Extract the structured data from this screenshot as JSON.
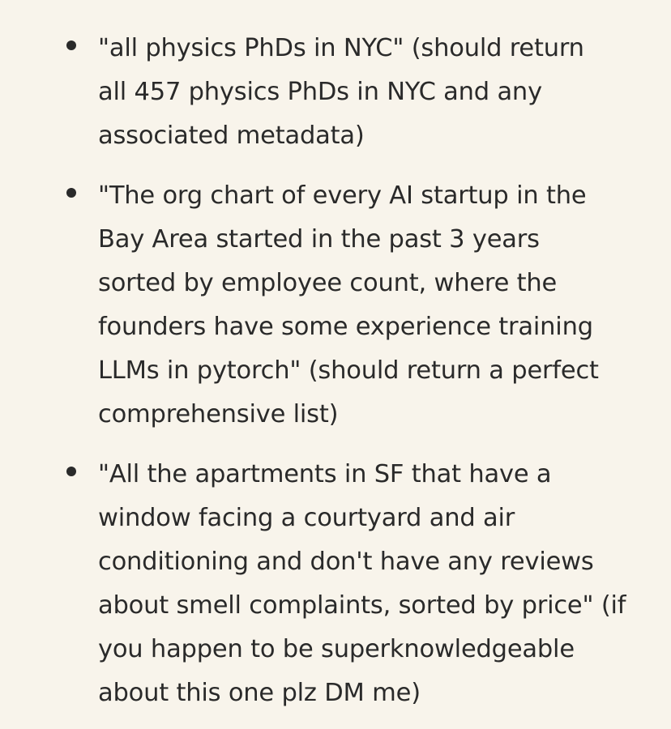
{
  "items": [
    {
      "lines": [
        "\"all physics PhDs in NYC\" (should return",
        "all 457 physics PhDs in NYC and any",
        "associated metadata)"
      ]
    },
    {
      "lines": [
        "\"The org chart of every AI startup in the",
        "Bay Area started in the past 3 years",
        "sorted by employee count, where the",
        "founders have some experience training",
        "LLMs in pytorch\" (should return a perfect",
        "comprehensive list)"
      ]
    },
    {
      "lines": [
        "\"All the apartments in SF that have a",
        "window facing a courtyard and air",
        "conditioning and don't have any reviews",
        "about smell complaints, sorted by price\" (if",
        "you happen to be superknowledgeable",
        "about this one plz DM me)"
      ]
    }
  ]
}
